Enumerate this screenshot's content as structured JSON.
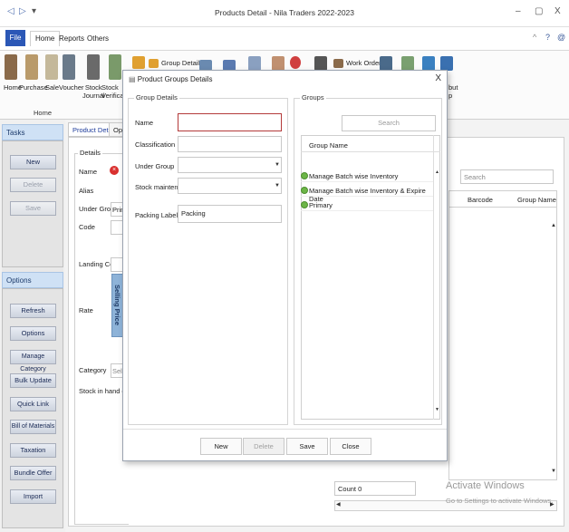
{
  "window": {
    "title": "Products Detail - Nila Traders 2022-2023",
    "minimize": "–",
    "maximize": "▢",
    "close": "X"
  },
  "quick_access": {
    "back": "◁",
    "forward": "▷",
    "dropdown": "▾"
  },
  "menu": {
    "file": "File",
    "tabs": [
      "Home",
      "Reports",
      "Others"
    ],
    "right_icons": [
      "^",
      "?",
      "@"
    ]
  },
  "ribbon": {
    "buttons": [
      {
        "label": "Home",
        "icon": "house-icon",
        "color": "#8a6a4a"
      },
      {
        "label": "Purchase",
        "icon": "purchase-icon",
        "color": "#b99a6a"
      },
      {
        "label": "Sale",
        "icon": "sale-icon",
        "color": "#c4b89a"
      },
      {
        "label": "Voucher",
        "icon": "voucher-icon",
        "color": "#6a7a8a"
      },
      {
        "label": "Stock\nJournal",
        "icon": "stock-journal-icon",
        "color": "#6a6a6a"
      },
      {
        "label": "Stock\nVerificatio",
        "icon": "stock-verification-icon",
        "color": "#7a9a6a"
      }
    ],
    "small_buttons": [
      {
        "label": "Group Details",
        "icon": "group-details-icon",
        "color": "#e0a030"
      },
      {
        "label": "Work Order",
        "icon": "work-order-icon",
        "color": "#8a6a4a"
      }
    ],
    "group_label": "Home",
    "partial_label": "but\np"
  },
  "tasks": {
    "header": "Tasks",
    "buttons": [
      {
        "label": "New",
        "disabled": false
      },
      {
        "label": "Delete",
        "disabled": true
      },
      {
        "label": "Save",
        "disabled": true
      }
    ]
  },
  "options": {
    "header": "Options",
    "buttons": [
      "Refresh",
      "Options",
      "Manage Category",
      "Bulk Update",
      "Quick Link",
      "Bill of Materials",
      "Taxation",
      "Bundle Offer",
      "Import"
    ]
  },
  "main": {
    "tabs": [
      "Product Details",
      "Ope"
    ],
    "details_title": "Details",
    "labels": {
      "name": "Name",
      "alias": "Alias",
      "under_group": "Under Group",
      "code": "Code",
      "landing_cost": "Landing Cost",
      "rate": "Rate",
      "category": "Category",
      "stock_in_hand": "Stock in hand g"
    },
    "under_group_value": "Prim",
    "category_placeholder": "Sele",
    "selling_price": "Selling Price",
    "search_placeholder": "Search",
    "columns": [
      "Barcode",
      "Group Name"
    ],
    "count": "Count 0"
  },
  "dialog": {
    "title": "Product Groups Details",
    "close": "X",
    "group_details_title": "Group Details",
    "groups_title": "Groups",
    "fields": {
      "name_label": "Name",
      "name_value": "",
      "classification_label": "Classification",
      "classification_value": "",
      "under_group_label": "Under Group",
      "under_group_value": "",
      "stock_maintenance_label": "Stock maintenance",
      "stock_maintenance_value": "",
      "packing_label_label": "Packing Label",
      "packing_label_value": "Packing"
    },
    "search_placeholder": "Search",
    "column_header": "Group Name",
    "groups": [
      "Manage Batch wise Inventory",
      "Manage Batch wise Inventory & Expire Date",
      "Primary"
    ],
    "buttons": {
      "new": "New",
      "delete": "Delete",
      "save": "Save",
      "close": "Close"
    }
  },
  "watermark": {
    "title": "Activate Windows",
    "subtitle": "Go to Settings to activate Windows."
  },
  "colors": {
    "accent": "#2b57b6",
    "panel_header": "#cfe1f5",
    "group_icon": "#6cb547",
    "name_field_border": "#b33a3a",
    "error_icon": "#d9302f"
  }
}
